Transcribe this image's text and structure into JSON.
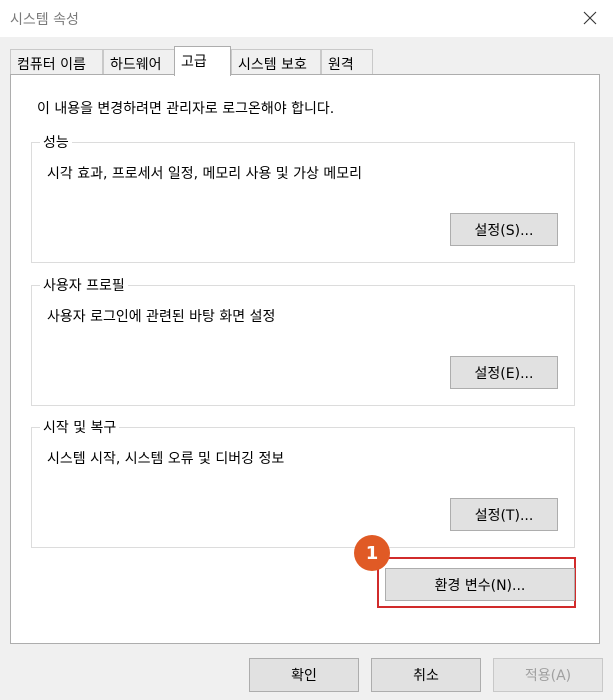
{
  "window": {
    "title": "시스템 속성",
    "close_icon": "close-icon"
  },
  "tabs": [
    {
      "label": "컴퓨터 이름",
      "active": false
    },
    {
      "label": "하드웨어",
      "active": false
    },
    {
      "label": "고급",
      "active": true
    },
    {
      "label": "시스템 보호",
      "active": false
    },
    {
      "label": "원격",
      "active": false
    }
  ],
  "panel": {
    "notice": "이 내용을 변경하려면 관리자로 로그온해야 합니다.",
    "groups": [
      {
        "title": "성능",
        "description": "시각 효과, 프로세서 일정, 메모리 사용 및 가상 메모리",
        "button": "설정(S)..."
      },
      {
        "title": "사용자 프로필",
        "description": "사용자 로그인에 관련된 바탕 화면 설정",
        "button": "설정(E)..."
      },
      {
        "title": "시작 및 복구",
        "description": "시스템 시작, 시스템 오류 및 디버깅 정보",
        "button": "설정(T)..."
      }
    ],
    "env_button": "환경 변수(N)...",
    "callout_number": "1",
    "callout_color": "#e05a25",
    "highlight_color": "#d12b2b"
  },
  "footer": {
    "ok": "확인",
    "cancel": "취소",
    "apply": "적용(A)",
    "apply_disabled": true
  }
}
